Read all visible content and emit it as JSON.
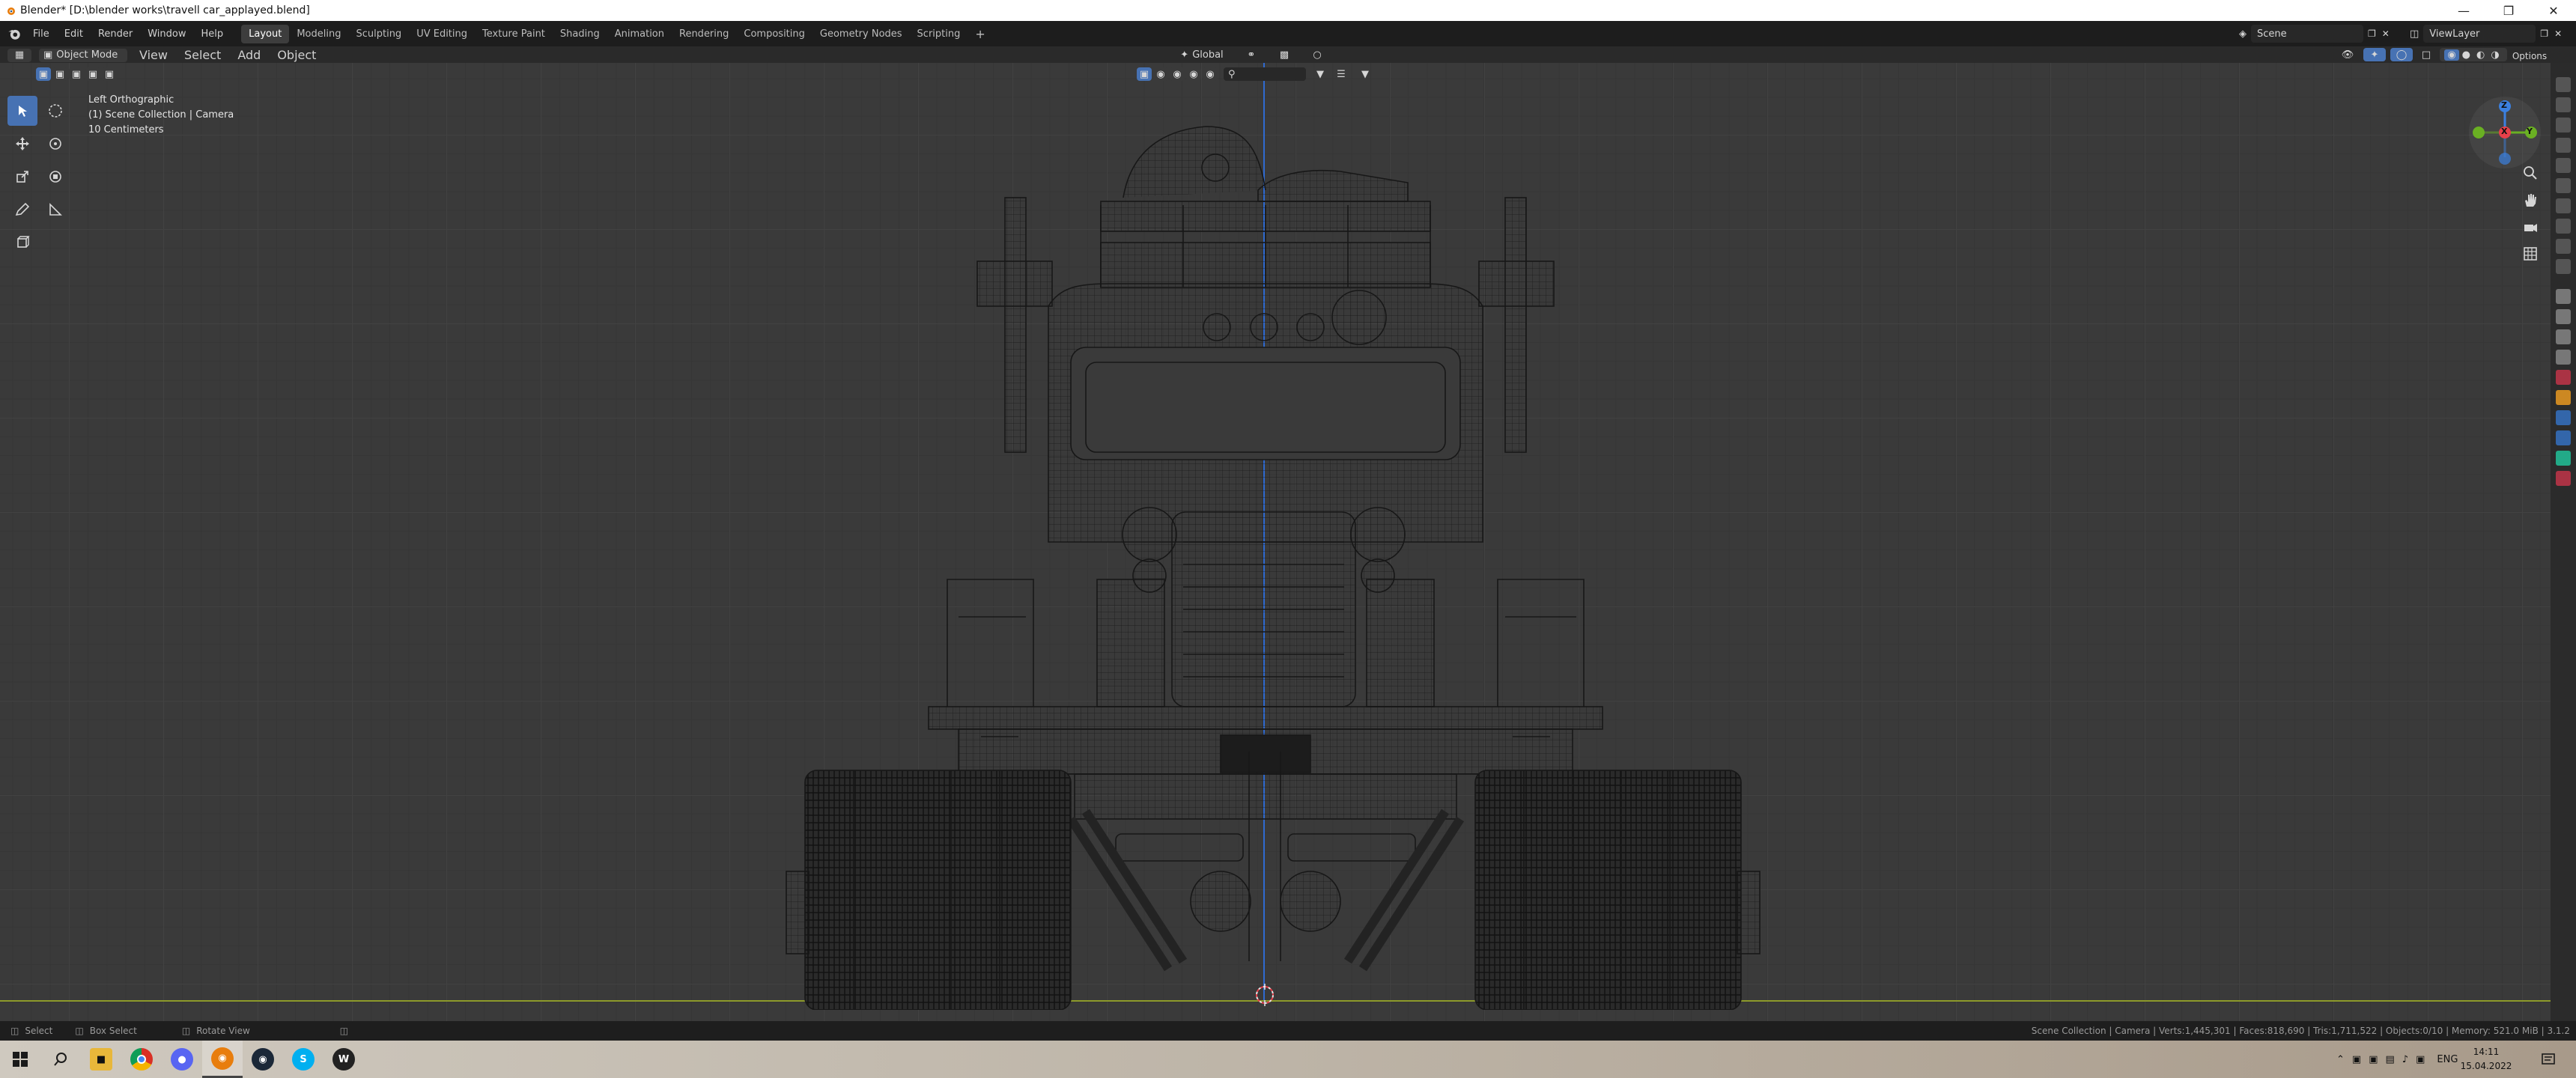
{
  "window": {
    "title": "Blender* [D:\\blender works\\travell car_applayed.blend]"
  },
  "menu": [
    "File",
    "Edit",
    "Render",
    "Window",
    "Help"
  ],
  "workspaces": [
    "Layout",
    "Modeling",
    "Sculpting",
    "UV Editing",
    "Texture Paint",
    "Shading",
    "Animation",
    "Rendering",
    "Compositing",
    "Geometry Nodes",
    "Scripting"
  ],
  "scene": {
    "label": "Scene",
    "view_layer": "ViewLayer"
  },
  "viewport_header": {
    "mode": "Object Mode",
    "menus": [
      "View",
      "Select",
      "Add",
      "Object"
    ],
    "orientation": "Global",
    "options": "Options"
  },
  "overlay": {
    "view_name": "Left Orthographic",
    "collection": "(1) Scene Collection | Camera",
    "scale": "10 Centimeters"
  },
  "gizmo": {
    "x": "X",
    "y": "Y",
    "z": "Z"
  },
  "status": {
    "select": "Select",
    "box_select": "Box Select",
    "rotate": "Rotate View",
    "stats": "Scene Collection | Camera | Verts:1,445,301 | Faces:818,690 | Tris:1,711,522 | Objects:0/10 | Memory: 521.0 MiB | 3.1.2"
  },
  "taskbar": {
    "lang": "ENG",
    "time": "14:11",
    "date": "15.04.2022"
  },
  "colors": {
    "active_tool": "#4772b3",
    "axis_x": "#e8404a",
    "axis_y": "#6ab023",
    "axis_z": "#3b80e0"
  }
}
